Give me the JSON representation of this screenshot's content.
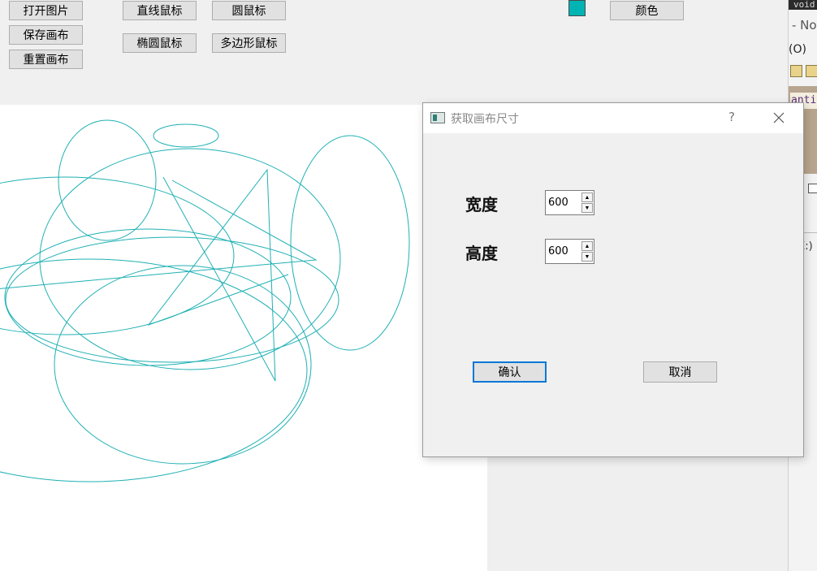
{
  "main_window": {
    "toolbar": {
      "open_image": "打开图片",
      "save_canvas": "保存画布",
      "reset_canvas": "重置画布",
      "line_brush": "直线鼠标",
      "circle_brush": "圆鼠标",
      "ellipse_brush": "椭圆鼠标",
      "polygon_brush": "多边形鼠标",
      "color_button": "颜色"
    },
    "current_color": "#00b4b4",
    "stroke_color": "#20b0b4"
  },
  "background_window": {
    "code_snippet": "void",
    "title_fragment": "- No",
    "menu_fragment": "(O)",
    "code_fragment": "antic",
    "misc_fragment": "E:)"
  },
  "dialog": {
    "title": "获取画布尺寸",
    "help_glyph": "?",
    "width_label": "宽度",
    "width_value": "600",
    "height_label": "高度",
    "height_value": "600",
    "confirm_label": "确认",
    "cancel_label": "取消",
    "accent_color": "#0078d7"
  }
}
